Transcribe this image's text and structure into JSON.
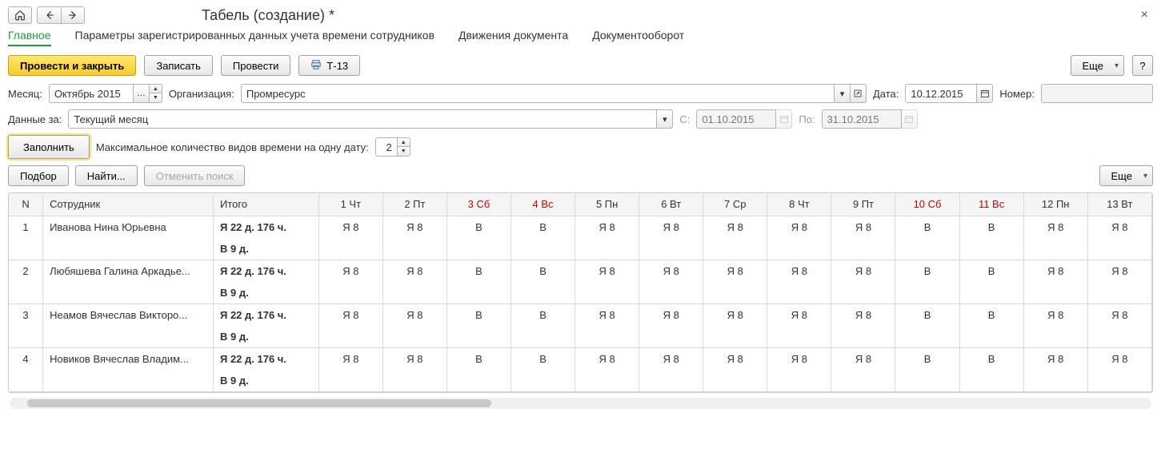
{
  "title": "Табель (создание) *",
  "tabs": [
    "Главное",
    "Параметры зарегистрированных данных учета времени сотрудников",
    "Движения документа",
    "Документооборот"
  ],
  "toolbar": {
    "post_close": "Провести и закрыть",
    "save": "Записать",
    "post": "Провести",
    "t13": "Т-13",
    "more": "Еще",
    "help": "?"
  },
  "form": {
    "month_label": "Месяц:",
    "month_value": "Октябрь 2015",
    "org_label": "Организация:",
    "org_value": "Промресурс",
    "date_label": "Дата:",
    "date_value": "10.12.2015",
    "number_label": "Номер:",
    "number_value": "",
    "data_for_label": "Данные за:",
    "data_for_value": "Текущий месяц",
    "from_label": "С:",
    "from_value": "01.10.2015",
    "to_label": "По:",
    "to_value": "31.10.2015",
    "fill": "Заполнить",
    "max_kinds_label": "Максимальное количество видов времени на одну дату:",
    "max_kinds_value": "2",
    "pick": "Подбор",
    "find": "Найти...",
    "cancel_find": "Отменить поиск"
  },
  "columns": {
    "n": "N",
    "emp": "Сотрудник",
    "sum": "Итого",
    "days": [
      {
        "label": "1 Чт",
        "weekend": false
      },
      {
        "label": "2 Пт",
        "weekend": false
      },
      {
        "label": "3 Сб",
        "weekend": true
      },
      {
        "label": "4 Вс",
        "weekend": true
      },
      {
        "label": "5 Пн",
        "weekend": false
      },
      {
        "label": "6 Вт",
        "weekend": false
      },
      {
        "label": "7 Ср",
        "weekend": false
      },
      {
        "label": "8 Чт",
        "weekend": false
      },
      {
        "label": "9 Пт",
        "weekend": false
      },
      {
        "label": "10 Сб",
        "weekend": true
      },
      {
        "label": "11 Вс",
        "weekend": true
      },
      {
        "label": "12 Пн",
        "weekend": false
      },
      {
        "label": "13 Вт",
        "weekend": false
      }
    ]
  },
  "rows": [
    {
      "n": "1",
      "emp": "Иванова Нина Юрьевна",
      "sum1": "Я 22 д.  176 ч.",
      "sum2": "В 9 д.",
      "cells": [
        "Я 8",
        "Я 8",
        "В",
        "В",
        "Я 8",
        "Я 8",
        "Я 8",
        "Я 8",
        "Я 8",
        "В",
        "В",
        "Я 8",
        "Я 8"
      ]
    },
    {
      "n": "2",
      "emp": "Любяшева Галина Аркадье...",
      "sum1": "Я 22 д.  176 ч.",
      "sum2": "В 9 д.",
      "cells": [
        "Я 8",
        "Я 8",
        "В",
        "В",
        "Я 8",
        "Я 8",
        "Я 8",
        "Я 8",
        "Я 8",
        "В",
        "В",
        "Я 8",
        "Я 8"
      ]
    },
    {
      "n": "3",
      "emp": "Неамов Вячеслав Викторо...",
      "sum1": "Я 22 д.  176 ч.",
      "sum2": "В 9 д.",
      "cells": [
        "Я 8",
        "Я 8",
        "В",
        "В",
        "Я 8",
        "Я 8",
        "Я 8",
        "Я 8",
        "Я 8",
        "В",
        "В",
        "Я 8",
        "Я 8"
      ]
    },
    {
      "n": "4",
      "emp": "Новиков Вячеслав Владим...",
      "sum1": "Я 22 д.  176 ч.",
      "sum2": "В 9 д.",
      "cells": [
        "Я 8",
        "Я 8",
        "В",
        "В",
        "Я 8",
        "Я 8",
        "Я 8",
        "Я 8",
        "Я 8",
        "В",
        "В",
        "Я 8",
        "Я 8"
      ]
    }
  ]
}
